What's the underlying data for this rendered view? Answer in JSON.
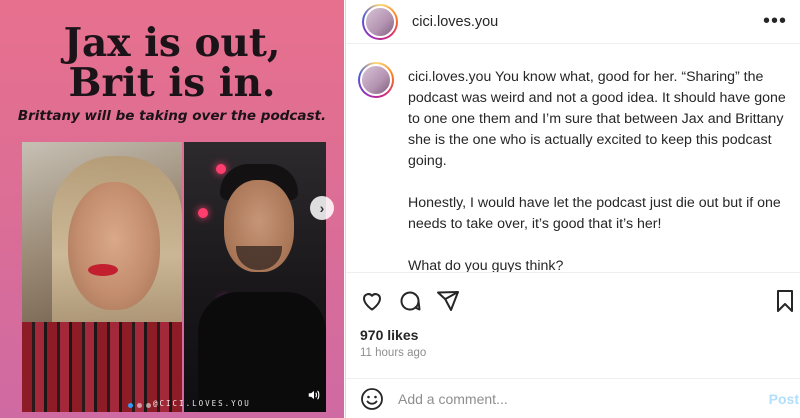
{
  "media": {
    "headline_line1": "Jax is out,",
    "headline_line2": "Brit is in.",
    "subline": "Brittany will be taking over the podcast.",
    "watermark": "@CICI.LOVES.YOU",
    "carousel_count": 3,
    "carousel_active_index": 1
  },
  "header": {
    "username": "cici.loves.you",
    "more_label": "•••"
  },
  "caption": {
    "username": "cici.loves.you",
    "text": " You know what, good for her. “Sharing” the podcast was weird and not a good idea. It should have gone to one one them and I’m sure that between Jax and Brittany she is the one who is actually excited to keep this podcast going.\n\nHonestly, I would have let the podcast just die out but if one needs to take over, it’s good that it’s her!\n\nWhat do you guys think?\n\n**I also added information about a recent podcast she released. I have been out of it for a few days myself due to my own stuff so I really enjoyed that. Hope it lets you know how she is doing as well!"
  },
  "engagement": {
    "likes": "970 likes",
    "timestamp": "11 hours ago"
  },
  "comment": {
    "placeholder": "Add a comment...",
    "post_label": "Post"
  },
  "icons": {
    "heart": "heart-icon",
    "comment": "comment-icon",
    "share": "share-icon",
    "save": "bookmark-icon",
    "emoji": "emoji-icon",
    "next": "chevron-right-icon",
    "mute": "speaker-icon"
  },
  "colors": {
    "accent": "#3897f0",
    "post_disabled": "#b2dffc",
    "muted_text": "#8e8e8e"
  }
}
